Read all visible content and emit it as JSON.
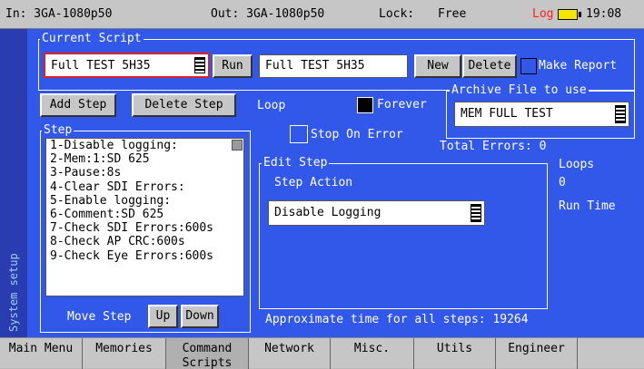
{
  "status": {
    "input": "In: 3GA-1080p50",
    "output": "Out: 3GA-1080p50",
    "lock_label": "Lock:",
    "lock_value": "Free",
    "log_label": "Log",
    "time": "19:08",
    "log_color": "#ff2020",
    "battery_color": "#f2e600"
  },
  "sidebar": {
    "label": "System setup"
  },
  "current_script": {
    "title": "Current Script",
    "selected": "Full TEST 5H35",
    "run_label": "Run",
    "name_value": "Full TEST 5H35",
    "new_label": "New",
    "delete_label": "Delete",
    "make_report_label": "Make Report"
  },
  "actions": {
    "add_step": "Add Step",
    "delete_step": "Delete Step",
    "loop_label": "Loop",
    "forever_label": "Forever",
    "stop_on_error": "Stop On Error"
  },
  "archive": {
    "title": "Archive File to use",
    "value": "MEM FULL TEST"
  },
  "total_errors": "Total Errors: 0",
  "loops": {
    "label": "Loops",
    "value": "0"
  },
  "run_time_label": "Run Time",
  "steps": {
    "title": "Step",
    "items": [
      "1-Disable logging:",
      "2-Mem:1:SD 625",
      "3-Pause:8s",
      "4-Clear SDI Errors:",
      "5-Enable logging:",
      "6-Comment:SD 625",
      "7-Check SDI Errors:600s",
      "8-Check AP CRC:600s",
      "9-Check Eye Errors:600s"
    ],
    "move_label": "Move Step",
    "up_label": "Up",
    "down_label": "Down"
  },
  "edit_step": {
    "title": "Edit Step",
    "action_label": "Step Action",
    "action_value": "Disable Logging"
  },
  "approx_time": "Approximate time for all steps: 19264",
  "tabs": [
    "Main Menu",
    "Memories",
    "Command Scripts",
    "Network",
    "Misc.",
    "Utils",
    "Engineer"
  ]
}
